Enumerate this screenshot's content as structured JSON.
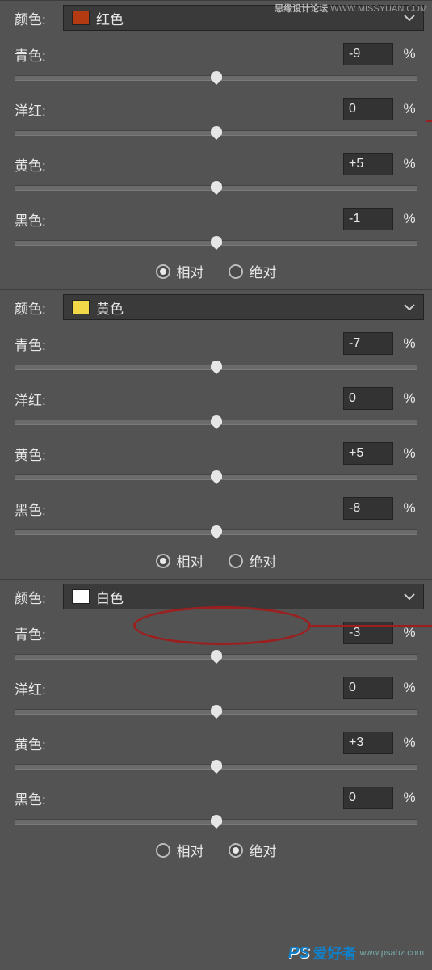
{
  "labels": {
    "color": "颜色:",
    "cyan": "青色:",
    "magenta": "洋红:",
    "yellow": "黄色:",
    "black": "黑色:",
    "pct": "%",
    "relative": "相对",
    "absolute": "绝对"
  },
  "sections": [
    {
      "swatch": "#b43a12",
      "name": "红色",
      "sliders": {
        "cyan": "-9",
        "magenta": "0",
        "yellow": "+5",
        "black": "-1"
      },
      "radio": "relative"
    },
    {
      "swatch": "#f2d749",
      "name": "黄色",
      "sliders": {
        "cyan": "-7",
        "magenta": "0",
        "yellow": "+5",
        "black": "-8"
      },
      "radio": "relative"
    },
    {
      "swatch": "#ffffff",
      "name": "白色",
      "sliders": {
        "cyan": "-3",
        "magenta": "0",
        "yellow": "+3",
        "black": "0"
      },
      "radio": "absolute"
    }
  ],
  "watermark": {
    "top1": "思缘设计论坛",
    "top2": "WWW.MISSYUAN.COM",
    "br_ps": "PS",
    "br_cn": "爱好者",
    "br_dom": "www.psahz.com"
  }
}
